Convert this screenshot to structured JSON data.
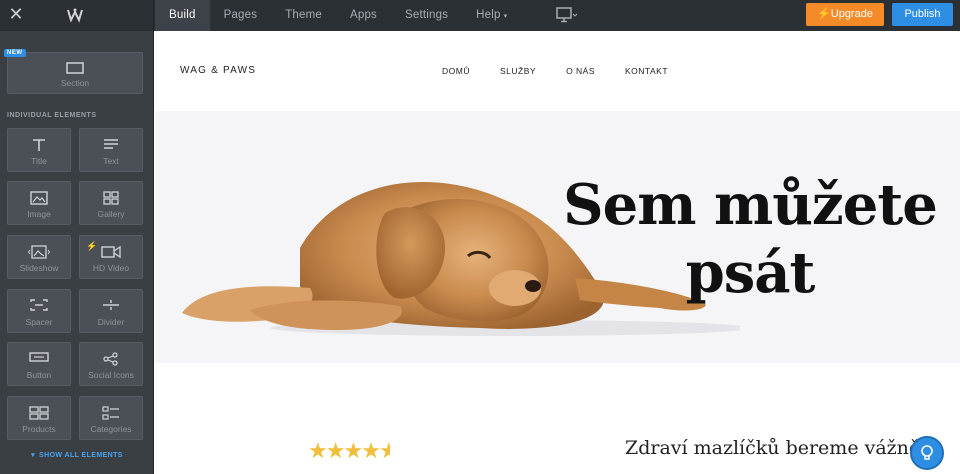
{
  "topbar": {
    "nav": [
      "Build",
      "Pages",
      "Theme",
      "Apps",
      "Settings",
      "Help"
    ],
    "upgrade_label": "Upgrade",
    "publish_label": "Publish"
  },
  "sidebar": {
    "new_badge": "NEW",
    "section_label": "Section",
    "heading": "INDIVIDUAL ELEMENTS",
    "tiles": [
      "Title",
      "Text",
      "Image",
      "Gallery",
      "Slideshow",
      "HD Video",
      "Spacer",
      "Divider",
      "Button",
      "Social Icons",
      "Products",
      "Categories"
    ],
    "show_all": "SHOW ALL ELEMENTS"
  },
  "site": {
    "name": "WAG & PAWS",
    "nav": [
      "DOMŮ",
      "SLUŽBY",
      "O NÁS",
      "KONTAKT"
    ],
    "hero_title_line1": "Sem můžete",
    "hero_title_line2": "psát",
    "rating": 4.5,
    "subheading": "Zdraví mazlíčků bereme vážně"
  },
  "colors": {
    "upgrade": "#f58b28",
    "publish": "#2d8ee3",
    "star": "#f0c03c"
  }
}
